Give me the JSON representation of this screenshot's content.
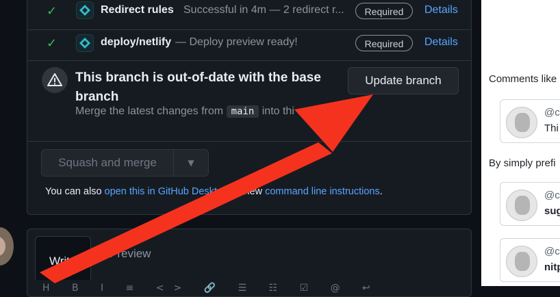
{
  "checks": [
    {
      "name": "Redirect rules",
      "description": "Successful in 4m — 2 redirect r...",
      "badge": "Required",
      "link": "Details"
    },
    {
      "name": "deploy/netlify",
      "description": "— Deploy preview ready!",
      "badge": "Required",
      "link": "Details"
    }
  ],
  "branch_notice": {
    "title": "This branch is out-of-date with the base branch",
    "subtitle_prefix": "Merge the latest changes from",
    "base_branch": "main",
    "subtitle_suffix": "into thi",
    "update_button": "Update branch"
  },
  "merge": {
    "button_label": "Squash and merge",
    "caret": "▼",
    "alt_text_prefix": "You can also",
    "desktop_link": "open this in GitHub Desktop",
    "alt_text_middle": "or view",
    "cli_link": "command line instructions",
    "alt_text_suffix": "."
  },
  "comment_tabs": {
    "write": "Write",
    "preview": "Preview"
  },
  "toolbar_icons": "H B I ≡ <> 🔗 ☰ ☷ ☑ @ ↩",
  "right_pane": {
    "text1": "Comments like",
    "text2": "By simply prefi",
    "cards": [
      {
        "user": "@c",
        "line": "Thi",
        "bold": false
      },
      {
        "user": "@c",
        "line": "sug",
        "bold": true
      },
      {
        "user": "@c",
        "line": "nitp",
        "bold": true
      }
    ]
  },
  "colors": {
    "accent": "#58a6ff",
    "success": "#3fb950",
    "annotation_arrow": "#f5321e"
  }
}
